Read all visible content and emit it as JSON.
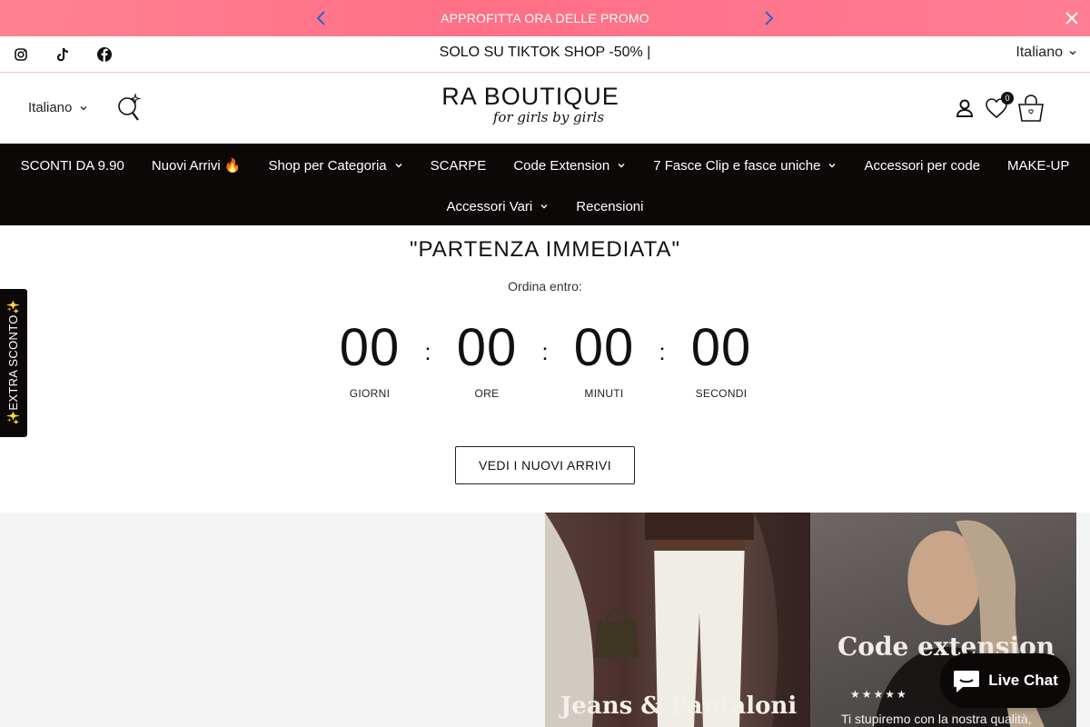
{
  "promo": {
    "text": "APPROFITTA ORA DELLE PROMO",
    "color": "#ff7388"
  },
  "subbar": {
    "text": "SOLO SU TIKTOK SHOP -50% |",
    "language": "Italiano",
    "social": [
      "instagram-icon",
      "tiktok-icon",
      "facebook-icon"
    ]
  },
  "header": {
    "language": "Italiano",
    "logo_main": "RA BOUTIQUE",
    "logo_sub": "for girls by girls",
    "wishlist_count": "0"
  },
  "nav": {
    "row1": [
      {
        "label": "SCONTI DA 9.90",
        "dropdown": false
      },
      {
        "label": "Nuovi Arrivi 🔥",
        "dropdown": false
      },
      {
        "label": "Shop per Categoria",
        "dropdown": true
      },
      {
        "label": "SCARPE",
        "dropdown": false
      },
      {
        "label": "Code Extension",
        "dropdown": true
      },
      {
        "label": "7 Fasce Clip e fasce uniche",
        "dropdown": true
      },
      {
        "label": "Accessori per code",
        "dropdown": false
      },
      {
        "label": "MAKE-UP",
        "dropdown": false
      }
    ],
    "row2": [
      {
        "label": "Accessori Vari",
        "dropdown": true
      },
      {
        "label": "Recensioni",
        "dropdown": false
      }
    ]
  },
  "countdown": {
    "title": "\"PARTENZA IMMEDIATA\"",
    "subtitle": "Ordina entro:",
    "units": [
      {
        "value": "00",
        "label": "GIORNI"
      },
      {
        "value": "00",
        "label": "ORE"
      },
      {
        "value": "00",
        "label": "MINUTI"
      },
      {
        "value": "00",
        "label": "SECONDI"
      }
    ],
    "separator": ":",
    "cta": "VEDI I NUOVI ARRIVI"
  },
  "sidetab": {
    "text": "✨EXTRA SCONTO✨"
  },
  "banners": {
    "jeans_title": "Jeans & Pantaloni",
    "code_title": "Code extension",
    "code_stars": "★★★★★",
    "code_desc": "Ti stupiremo con la nostra qualità,"
  },
  "chat": {
    "label": "Live Chat"
  }
}
